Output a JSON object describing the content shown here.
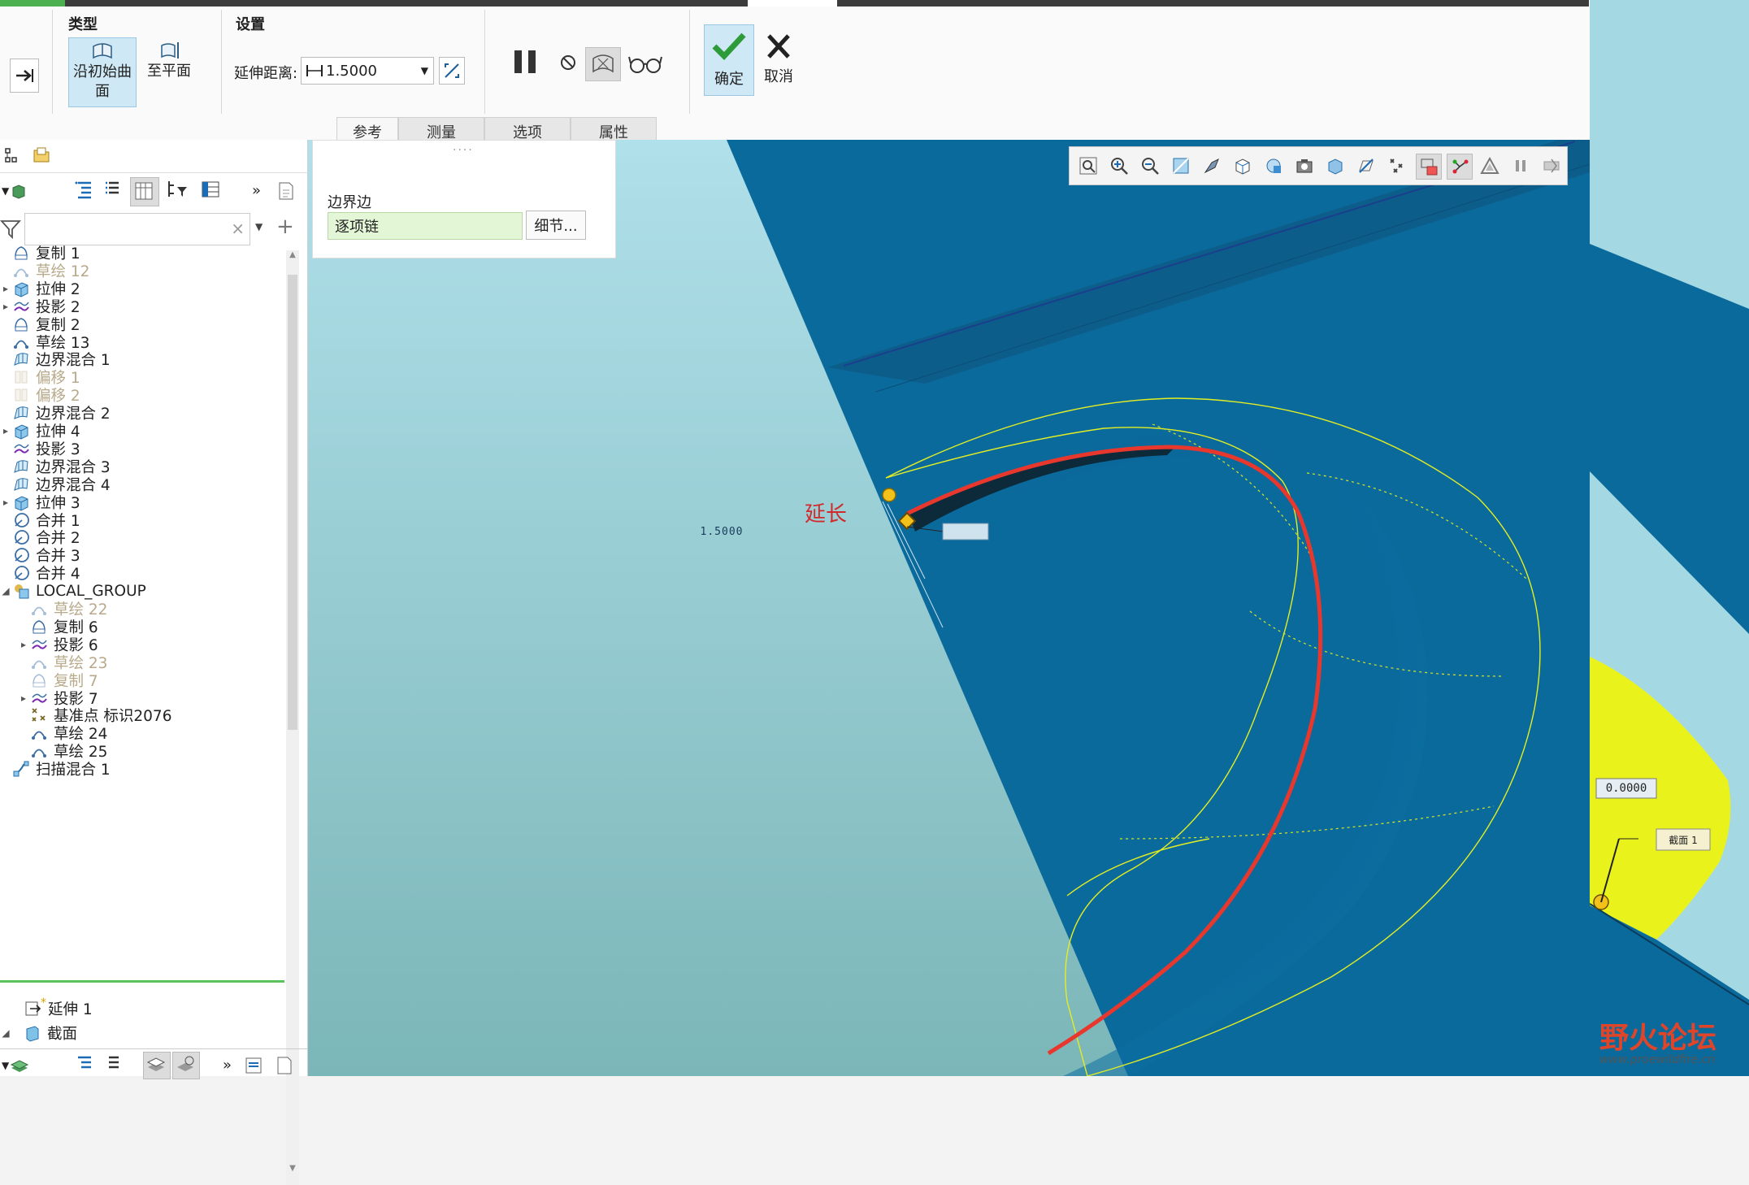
{
  "ribbon": {
    "type_group": "类型",
    "type_btn_along": "沿初始曲面",
    "type_btn_plane": "至平面",
    "settings_group": "设置",
    "extend_label": "延伸距离:",
    "extend_value": "1.5000",
    "ok_label": "确定",
    "cancel_label": "取消"
  },
  "tabs": [
    "参考",
    "测量",
    "选项",
    "属性"
  ],
  "ref_panel": {
    "boundary_label": "边界边",
    "chain_value": "逐项链",
    "details_button": "细节..."
  },
  "model_tree": [
    {
      "label": "复制 1",
      "icon": "copy-icon",
      "state": "normal",
      "expand": false
    },
    {
      "label": "草绘 12",
      "icon": "sketch-icon",
      "state": "suppressed",
      "expand": false
    },
    {
      "label": "拉伸 2",
      "icon": "extrude-icon",
      "state": "normal",
      "expand": true
    },
    {
      "label": "投影 2",
      "icon": "projection-icon",
      "state": "normal",
      "expand": true
    },
    {
      "label": "复制 2",
      "icon": "copy-icon",
      "state": "normal",
      "expand": false
    },
    {
      "label": "草绘 13",
      "icon": "sketch-icon",
      "state": "normal",
      "expand": false
    },
    {
      "label": "边界混合 1",
      "icon": "boundary-blend-icon",
      "state": "normal",
      "expand": false
    },
    {
      "label": "偏移 1",
      "icon": "offset-icon",
      "state": "suppressed",
      "expand": false
    },
    {
      "label": "偏移 2",
      "icon": "offset-icon",
      "state": "suppressed",
      "expand": false
    },
    {
      "label": "边界混合 2",
      "icon": "boundary-blend-icon",
      "state": "normal",
      "expand": false
    },
    {
      "label": "拉伸 4",
      "icon": "extrude-icon",
      "state": "normal",
      "expand": true
    },
    {
      "label": "投影 3",
      "icon": "projection-icon",
      "state": "normal",
      "expand": false
    },
    {
      "label": "边界混合 3",
      "icon": "boundary-blend-icon",
      "state": "normal",
      "expand": false
    },
    {
      "label": "边界混合 4",
      "icon": "boundary-blend-icon",
      "state": "normal",
      "expand": false
    },
    {
      "label": "拉伸 3",
      "icon": "extrude-icon",
      "state": "normal",
      "expand": true
    },
    {
      "label": "合并 1",
      "icon": "merge-icon",
      "state": "normal",
      "expand": false
    },
    {
      "label": "合并 2",
      "icon": "merge-icon",
      "state": "normal",
      "expand": false
    },
    {
      "label": "合并 3",
      "icon": "merge-icon",
      "state": "normal",
      "expand": false
    },
    {
      "label": "合并 4",
      "icon": "merge-icon",
      "state": "normal",
      "expand": false
    },
    {
      "label": "LOCAL_GROUP",
      "icon": "group-icon",
      "state": "normal",
      "expand": "open"
    },
    {
      "label": "草绘 22",
      "icon": "sketch-icon",
      "state": "suppressed",
      "expand": false,
      "child": true
    },
    {
      "label": "复制 6",
      "icon": "copy-icon",
      "state": "normal",
      "expand": false,
      "child": true
    },
    {
      "label": "投影 6",
      "icon": "projection-icon",
      "state": "normal",
      "expand": true,
      "child": true
    },
    {
      "label": "草绘 23",
      "icon": "sketch-icon",
      "state": "suppressed",
      "expand": false,
      "child": true
    },
    {
      "label": "复制 7",
      "icon": "copy-icon",
      "state": "suppressed",
      "expand": false,
      "child": true
    },
    {
      "label": "投影 7",
      "icon": "projection-icon",
      "state": "normal",
      "expand": true,
      "child": true
    },
    {
      "label": "基准点 标识2076",
      "icon": "datum-point-icon",
      "state": "normal",
      "expand": false,
      "child": true
    },
    {
      "label": "草绘 24",
      "icon": "sketch-icon",
      "state": "normal",
      "expand": false,
      "child": true
    },
    {
      "label": "草绘 25",
      "icon": "sketch-icon",
      "state": "normal",
      "expand": false,
      "child": true
    },
    {
      "label": "扫描混合 1",
      "icon": "sweep-blend-icon",
      "state": "normal",
      "expand": false
    }
  ],
  "model_tree_bottom": [
    {
      "label": "延伸 1",
      "icon": "extend-icon"
    },
    {
      "label": "截面",
      "icon": "section-icon"
    }
  ],
  "viewport": {
    "dim_value": "1.5000",
    "annotation": "延长",
    "dim_value2": "0.0000",
    "section_tag": "截面 1"
  },
  "watermark": {
    "title": "野火论坛",
    "url": "www.proewildfire.cn"
  },
  "colors": {
    "selection_blue": "#cfe8f5",
    "surface_blue": "#0b6ea0",
    "highlight_red": "#e8372c",
    "preview_yellow": "#e6f01c"
  }
}
